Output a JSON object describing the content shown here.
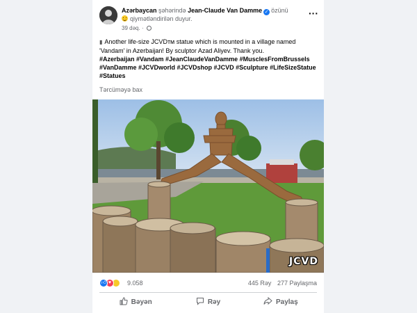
{
  "post": {
    "header": {
      "location": "Azərbaycan",
      "location_suffix": " şəhərində ",
      "author": "Jean-Claude Van Damme",
      "self_tag": "özünü",
      "feeling": "qiymətləndirilən duyur.",
      "time": "39 dəq.",
      "time_sep": "·"
    },
    "text": "Another life-size JCVDᴛᴍ statue which is mounted in a village named 'Vandam' in Azerbaijan! By sculptor Azad Aliyev. Thank you.",
    "hashtags": "#Azerbaijan #Vandam #JeanClaudeVanDamme #MusclesFromBrussels #VanDamme #JCVDworld #JCVDshop #JCVD #Sculpture #LifeSizeStatue #Statues",
    "translate_label": "Tərcüməyə bax",
    "image": {
      "watermark": "JCVD"
    },
    "stats": {
      "reactions_count": "9.058",
      "comments": "445 Rəy",
      "shares": "277 Paylaşma"
    },
    "actions": {
      "like": "Bəyən",
      "comment": "Rəy",
      "share": "Paylaş"
    }
  },
  "colors": {
    "accent": "#1877f2",
    "text": "#050505",
    "secondary_text": "#65676b",
    "background": "#f0f2f5"
  },
  "icons": [
    "globe-icon",
    "more-options-icon",
    "verified-icon",
    "feeling-emoji-icon",
    "like-reaction-icon",
    "love-reaction-icon",
    "wow-reaction-icon",
    "like-icon",
    "comment-icon",
    "share-icon"
  ]
}
